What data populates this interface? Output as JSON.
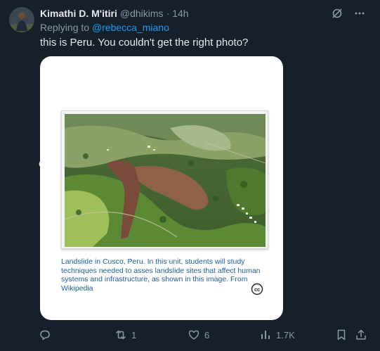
{
  "tweet": {
    "display_name": "Kimathi D. M'itiri",
    "handle": "@dhikims",
    "separator": "·",
    "time": "14h",
    "replying_prefix": "Replying to",
    "replying_to": "@rebecca_miano",
    "text": "this is Peru. You couldn't get the right photo?",
    "stray_text": "e."
  },
  "media": {
    "caption": "Landslide in Cusco, Peru. In this unit, students will study techniques needed to asses landslide sites that affect human systems and infrastructure, as shown in this image. From Wikipedia",
    "license_icon": "creative-commons-icon"
  },
  "actions": {
    "reply_count": "",
    "retweet_count": "1",
    "like_count": "6",
    "views_count": "1.7K"
  },
  "colors": {
    "background": "#15202b",
    "accent": "#1d9bf0",
    "secondary_text": "#8b98a5",
    "caption_text": "#1f5fa0"
  }
}
